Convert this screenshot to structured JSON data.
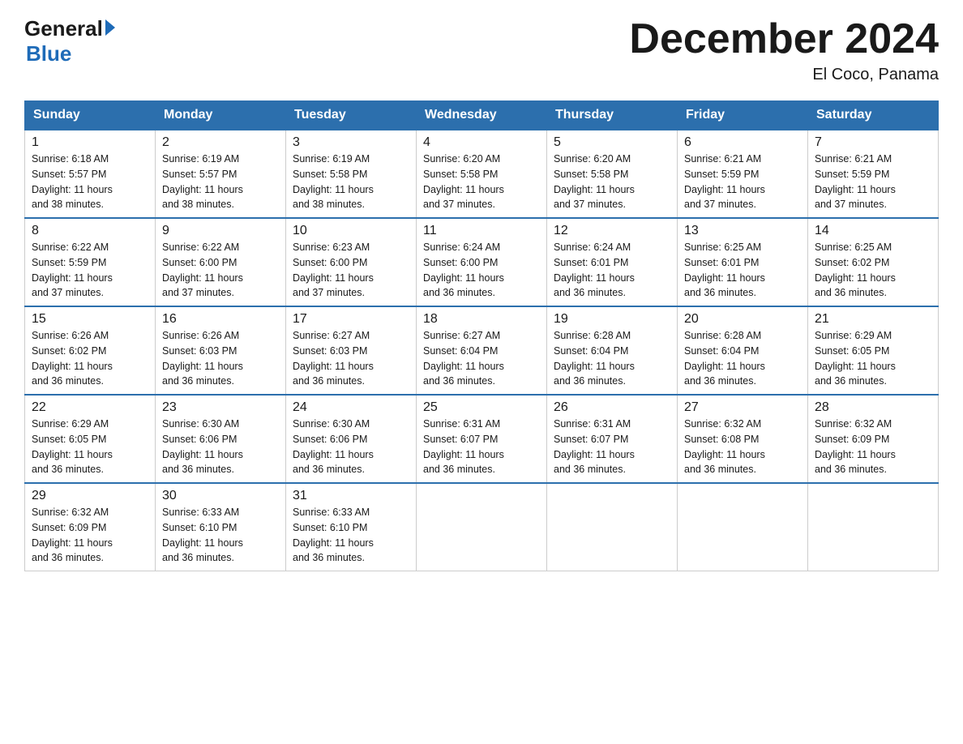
{
  "header": {
    "logo_general": "General",
    "logo_blue": "Blue",
    "title": "December 2024",
    "location": "El Coco, Panama"
  },
  "weekdays": [
    "Sunday",
    "Monday",
    "Tuesday",
    "Wednesday",
    "Thursday",
    "Friday",
    "Saturday"
  ],
  "weeks": [
    [
      {
        "day": "1",
        "sunrise": "6:18 AM",
        "sunset": "5:57 PM",
        "daylight": "11 hours and 38 minutes."
      },
      {
        "day": "2",
        "sunrise": "6:19 AM",
        "sunset": "5:57 PM",
        "daylight": "11 hours and 38 minutes."
      },
      {
        "day": "3",
        "sunrise": "6:19 AM",
        "sunset": "5:58 PM",
        "daylight": "11 hours and 38 minutes."
      },
      {
        "day": "4",
        "sunrise": "6:20 AM",
        "sunset": "5:58 PM",
        "daylight": "11 hours and 37 minutes."
      },
      {
        "day": "5",
        "sunrise": "6:20 AM",
        "sunset": "5:58 PM",
        "daylight": "11 hours and 37 minutes."
      },
      {
        "day": "6",
        "sunrise": "6:21 AM",
        "sunset": "5:59 PM",
        "daylight": "11 hours and 37 minutes."
      },
      {
        "day": "7",
        "sunrise": "6:21 AM",
        "sunset": "5:59 PM",
        "daylight": "11 hours and 37 minutes."
      }
    ],
    [
      {
        "day": "8",
        "sunrise": "6:22 AM",
        "sunset": "5:59 PM",
        "daylight": "11 hours and 37 minutes."
      },
      {
        "day": "9",
        "sunrise": "6:22 AM",
        "sunset": "6:00 PM",
        "daylight": "11 hours and 37 minutes."
      },
      {
        "day": "10",
        "sunrise": "6:23 AM",
        "sunset": "6:00 PM",
        "daylight": "11 hours and 37 minutes."
      },
      {
        "day": "11",
        "sunrise": "6:24 AM",
        "sunset": "6:00 PM",
        "daylight": "11 hours and 36 minutes."
      },
      {
        "day": "12",
        "sunrise": "6:24 AM",
        "sunset": "6:01 PM",
        "daylight": "11 hours and 36 minutes."
      },
      {
        "day": "13",
        "sunrise": "6:25 AM",
        "sunset": "6:01 PM",
        "daylight": "11 hours and 36 minutes."
      },
      {
        "day": "14",
        "sunrise": "6:25 AM",
        "sunset": "6:02 PM",
        "daylight": "11 hours and 36 minutes."
      }
    ],
    [
      {
        "day": "15",
        "sunrise": "6:26 AM",
        "sunset": "6:02 PM",
        "daylight": "11 hours and 36 minutes."
      },
      {
        "day": "16",
        "sunrise": "6:26 AM",
        "sunset": "6:03 PM",
        "daylight": "11 hours and 36 minutes."
      },
      {
        "day": "17",
        "sunrise": "6:27 AM",
        "sunset": "6:03 PM",
        "daylight": "11 hours and 36 minutes."
      },
      {
        "day": "18",
        "sunrise": "6:27 AM",
        "sunset": "6:04 PM",
        "daylight": "11 hours and 36 minutes."
      },
      {
        "day": "19",
        "sunrise": "6:28 AM",
        "sunset": "6:04 PM",
        "daylight": "11 hours and 36 minutes."
      },
      {
        "day": "20",
        "sunrise": "6:28 AM",
        "sunset": "6:04 PM",
        "daylight": "11 hours and 36 minutes."
      },
      {
        "day": "21",
        "sunrise": "6:29 AM",
        "sunset": "6:05 PM",
        "daylight": "11 hours and 36 minutes."
      }
    ],
    [
      {
        "day": "22",
        "sunrise": "6:29 AM",
        "sunset": "6:05 PM",
        "daylight": "11 hours and 36 minutes."
      },
      {
        "day": "23",
        "sunrise": "6:30 AM",
        "sunset": "6:06 PM",
        "daylight": "11 hours and 36 minutes."
      },
      {
        "day": "24",
        "sunrise": "6:30 AM",
        "sunset": "6:06 PM",
        "daylight": "11 hours and 36 minutes."
      },
      {
        "day": "25",
        "sunrise": "6:31 AM",
        "sunset": "6:07 PM",
        "daylight": "11 hours and 36 minutes."
      },
      {
        "day": "26",
        "sunrise": "6:31 AM",
        "sunset": "6:07 PM",
        "daylight": "11 hours and 36 minutes."
      },
      {
        "day": "27",
        "sunrise": "6:32 AM",
        "sunset": "6:08 PM",
        "daylight": "11 hours and 36 minutes."
      },
      {
        "day": "28",
        "sunrise": "6:32 AM",
        "sunset": "6:09 PM",
        "daylight": "11 hours and 36 minutes."
      }
    ],
    [
      {
        "day": "29",
        "sunrise": "6:32 AM",
        "sunset": "6:09 PM",
        "daylight": "11 hours and 36 minutes."
      },
      {
        "day": "30",
        "sunrise": "6:33 AM",
        "sunset": "6:10 PM",
        "daylight": "11 hours and 36 minutes."
      },
      {
        "day": "31",
        "sunrise": "6:33 AM",
        "sunset": "6:10 PM",
        "daylight": "11 hours and 36 minutes."
      },
      null,
      null,
      null,
      null
    ]
  ],
  "labels": {
    "sunrise": "Sunrise:",
    "sunset": "Sunset:",
    "daylight": "Daylight:"
  }
}
